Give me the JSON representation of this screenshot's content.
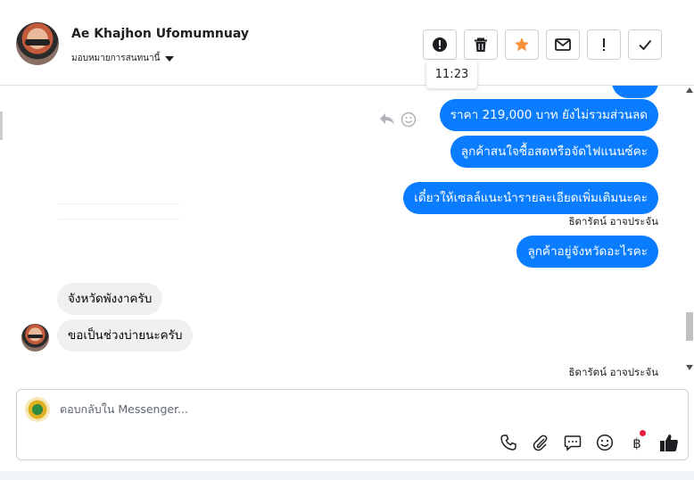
{
  "header": {
    "contact_name": "Ae Khajhon Ufomumnuay",
    "assign_label": "มอบหมายการสนทนานี้",
    "tooltip_time": "11:23",
    "actions": [
      {
        "name": "spam-button",
        "icon": "alert-circle-icon"
      },
      {
        "name": "delete-button",
        "icon": "trash-icon"
      },
      {
        "name": "star-button",
        "icon": "star-icon",
        "color": "#f7923b"
      },
      {
        "name": "unread-button",
        "icon": "envelope-icon"
      },
      {
        "name": "follow-up-button",
        "icon": "exclamation-icon"
      },
      {
        "name": "done-button",
        "icon": "check-icon"
      }
    ]
  },
  "thread": {
    "messages": [
      {
        "direction": "outgoing",
        "text": "ราคา 219,000 บาท ยังไม่รวมส่วนลด"
      },
      {
        "direction": "outgoing",
        "text": "ลูกค้าสนใจซื้อสดหรือจัดไฟแนนซ์คะ"
      },
      {
        "direction": "outgoing",
        "text": "เดี๋ยวให้เซลล์แนะนำรายละเอียดเพิ่มเติมนะคะ"
      },
      {
        "direction": "outgoing",
        "text": "ลูกค้าอยู่จังหวัดอะไรคะ"
      },
      {
        "direction": "incoming",
        "text": "จังหวัดพังงาครับ"
      },
      {
        "direction": "incoming",
        "text": "ขอเป็นช่วงบ่ายนะครับ"
      }
    ],
    "sender_label_1": "ธิดารัตน์ อาจประจัน",
    "sender_label_2": "ธิดารัตน์ อาจประจัน"
  },
  "composer": {
    "placeholder": "ตอบกลับใน Messenger...",
    "tools": [
      "phone-icon",
      "paperclip-icon",
      "chat-bubble-icon",
      "emoji-icon",
      "baht-icon",
      "thumbs-up-icon"
    ]
  },
  "colors": {
    "outgoing_bubble": "#0a7cff",
    "incoming_bubble": "#f0f0f0",
    "star": "#f7923b",
    "notification_dot": "#e41e3f"
  }
}
